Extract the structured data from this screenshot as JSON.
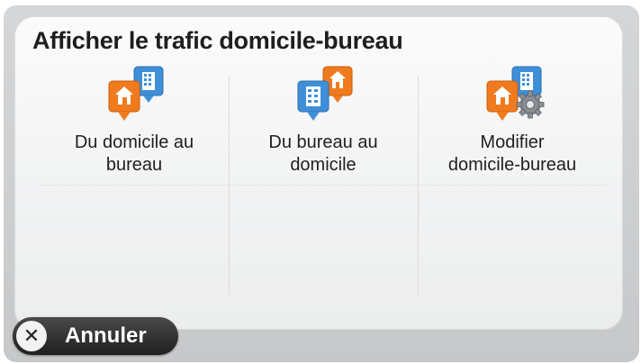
{
  "dialog": {
    "title": "Afficher le trafic domicile-bureau"
  },
  "options": [
    {
      "line1": "Du domicile au",
      "line2": "bureau",
      "icon": "home-to-office-icon"
    },
    {
      "line1": "Du bureau au",
      "line2": "domicile",
      "icon": "office-to-home-icon"
    },
    {
      "line1": "Modifier",
      "line2": "domicile-bureau",
      "icon": "edit-home-office-icon"
    }
  ],
  "footer": {
    "cancel_label": "Annuler"
  },
  "colors": {
    "home_orange": "#f07a1e",
    "office_blue": "#3f8fd8",
    "gear_gray": "#8a8f96"
  }
}
